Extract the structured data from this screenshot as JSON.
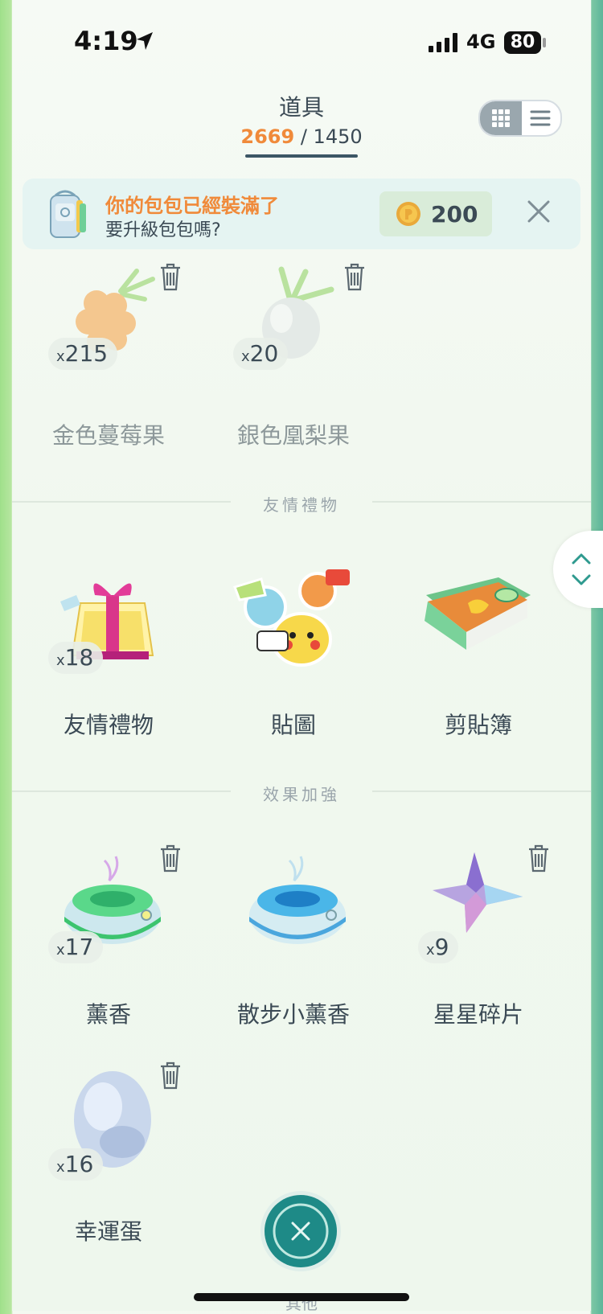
{
  "status_bar": {
    "time": "4:19",
    "network": "4G",
    "battery": "80"
  },
  "header": {
    "title": "道具",
    "count_current": "2669",
    "count_separator": "/",
    "count_max": "1450"
  },
  "view_toggle": {
    "grid": "grid-view-icon",
    "list": "list-view-icon"
  },
  "upgrade_banner": {
    "headline": "你的包包已經裝滿了",
    "subtitle": "要升級包包嗎?",
    "price": "200"
  },
  "sections": {
    "berries": {
      "items": [
        {
          "label": "金色蔓莓果",
          "quantity": "215",
          "prefix": "x",
          "deletable": true
        },
        {
          "label": "銀色凰梨果",
          "quantity": "20",
          "prefix": "x",
          "deletable": true
        }
      ]
    },
    "friendship": {
      "title": "友情禮物",
      "items": [
        {
          "label": "友情禮物",
          "quantity": "18",
          "prefix": "x"
        },
        {
          "label": "貼圖"
        },
        {
          "label": "剪貼簿"
        }
      ]
    },
    "boosts": {
      "title": "效果加強",
      "items": [
        {
          "label": "薰香",
          "quantity": "17",
          "prefix": "x",
          "deletable": true
        },
        {
          "label": "散步小薰香"
        },
        {
          "label": "星星碎片",
          "quantity": "9",
          "prefix": "x",
          "deletable": true
        },
        {
          "label": "幸運蛋",
          "quantity": "16",
          "prefix": "x",
          "deletable": true
        }
      ]
    },
    "other": {
      "title": "其他"
    }
  },
  "colors": {
    "accent_orange": "#f08a3a",
    "close_button": "#1e8a87",
    "text_dark": "#3b4a55"
  }
}
